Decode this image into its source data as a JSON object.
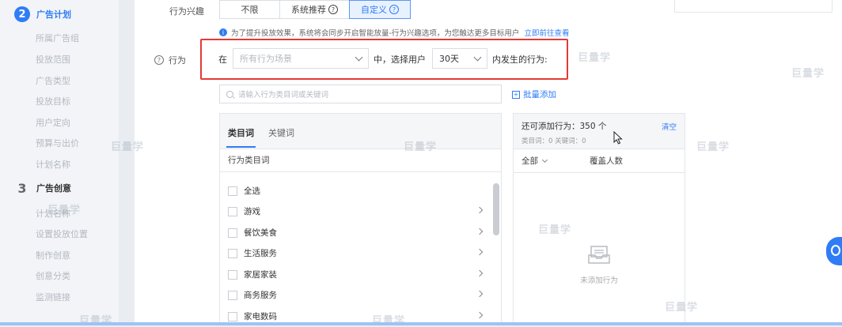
{
  "sidebar": {
    "step2": {
      "num": "2",
      "title": "广告计划"
    },
    "step2_items": [
      "所属广告组",
      "投放范围",
      "广告类型",
      "投放目标",
      "用户定向",
      "预算与出价",
      "计划名称"
    ],
    "step3": {
      "num": "3",
      "title": "广告创意"
    },
    "step3_items": [
      "计划名称",
      "设置投放位置",
      "制作创意",
      "创意分类",
      "监测链接"
    ]
  },
  "interest": {
    "label": "行为兴趣",
    "options": [
      "不限",
      "系统推荐",
      "自定义"
    ],
    "tip": "为了提升投放效果，系统将会同步开启智能放量-行为兴趣选项，为您触达更多目标用户",
    "tip_link": "立即前往查看"
  },
  "behavior": {
    "label": "行为",
    "prefix": "在",
    "scene_placeholder": "所有行为场景",
    "middle": "中，选择用户",
    "days": "30天",
    "suffix": "内发生的行为:"
  },
  "search": {
    "placeholder": "请输入行为类目词或关键词",
    "batch_add": "批量添加"
  },
  "left_panel": {
    "tabs": [
      "类目词",
      "关键词"
    ],
    "header": "行为类目词",
    "items": [
      "全选",
      "游戏",
      "餐饮美食",
      "生活服务",
      "家居家装",
      "商务服务",
      "家电数码"
    ]
  },
  "right_panel": {
    "title": "还可添加行为：350 个",
    "clear": "清空",
    "sub": "类目词：0    关键词：0",
    "col_all": "全部",
    "col_cover": "覆盖人数",
    "empty": "未添加行为"
  },
  "watermark": "巨量学"
}
